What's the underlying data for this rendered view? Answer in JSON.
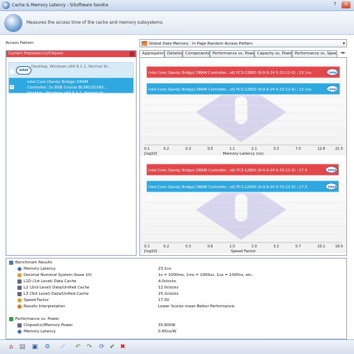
{
  "window": {
    "title": "Cache & Memory Latency - SiSoftware Sandra"
  },
  "banner": {
    "message": "Measures the access time of the cache and memory subsystems."
  },
  "access_pattern": {
    "label": "Access Pattern",
    "selected": "Global Data Memory : In Page Random Access Pattern"
  },
  "devices": {
    "header": "Current Processor(s)/Chipset",
    "items": [
      {
        "icon_text": "intel",
        "line1": "",
        "line2": "",
        "line3": "Desktop, Windows x64 6.1.1, Normal St...",
        "checked": false
      },
      {
        "icon_text": "intel",
        "line1": "Intel Core (Sandy Bridge) DRAM",
        "line2": "Controller; 2x 8GB Crucial BLS8G3D169...",
        "line3": "Desktop, Windows x64 6.1.1, Normal St...",
        "checked": true
      }
    ]
  },
  "tabs": [
    "Aggregated",
    "Detailed",
    "Components",
    "Performance vs. Power",
    "Capacity vs. Power",
    "Performance vs. Speed"
  ],
  "tab_scroll": "◄►",
  "colors": {
    "red": "#e2474b",
    "blue": "#2fa8e0",
    "selected": "#2fa8e0"
  },
  "chart_data": [
    {
      "type": "bar",
      "orientation": "horizontal",
      "xlabel": "Memory Latency (ns)",
      "scale_label": "[log10]",
      "scale": "log",
      "ticks": [
        "0.1",
        "0.2",
        "0.3",
        "0.5",
        "1.1",
        "2.1",
        "3.3",
        "7.0",
        "12.8",
        "21.5"
      ],
      "bars": [
        {
          "label": "Intel Core (Sandy Bridge) DRAM Controller...rd) PC3-12800 (9-9-9-24 5-33-12-6) : 23.1ns",
          "color": "#e2474b",
          "value": 23.1
        },
        {
          "label": "Intel Core (Sandy Bridge) DRAM Controller...rd) PC3-12800 (9-9-9-24 5-33-12-6) : 23.1ns",
          "color": "#2fa8e0",
          "value": 23.1
        }
      ]
    },
    {
      "type": "bar",
      "orientation": "horizontal",
      "xlabel": "Speed Factor",
      "scale_label": "[log10]",
      "scale": "log",
      "ticks": [
        "0.1",
        "0.2",
        "0.3",
        "0.6",
        "1.0",
        "2.0",
        "3.2",
        "5.7",
        "10.1",
        "18.0"
      ],
      "bars": [
        {
          "label": "Intel Core (Sandy Bridge) DRAM Controller...rd) PC3-12800 (9-9-9-24 5-33-12-6) : 17.5",
          "color": "#e2474b",
          "value": 17.5
        },
        {
          "label": "Intel Core (Sandy Bridge) DRAM Controller...rd) PC3-12800 (9-9-9-24 5-33-12-6) : 17.5",
          "color": "#2fa8e0",
          "value": 17.5
        }
      ]
    }
  ],
  "results": [
    {
      "indent": 0,
      "name": "Benchmark Results",
      "value": "",
      "icon": "result-icon",
      "color": "#4a7ab8"
    },
    {
      "indent": 1,
      "name": "Memory Latency",
      "value": "23.1ns",
      "icon": "diamond-icon",
      "color": "#3a6ad0"
    },
    {
      "indent": 1,
      "name": "Decimal Numeral System (base 10)",
      "value": "1s = 1000ms, 1ms = 1000us, 1us = 1000ns, etc.",
      "icon": "star-icon",
      "color": "#e0a020"
    },
    {
      "indent": 1,
      "name": "L1D (1st Level) Data Cache",
      "value": "4.0clocks",
      "icon": "cache-icon",
      "color": "#5a6a80"
    },
    {
      "indent": 1,
      "name": "L2 (2nd Level) Data/Unified Cache",
      "value": "12.0clocks",
      "icon": "cache-icon",
      "color": "#5a6a80"
    },
    {
      "indent": 1,
      "name": "L3 (3rd Level) Data/Unified Cache",
      "value": "25.2clocks",
      "icon": "cache-icon",
      "color": "#5a6a80"
    },
    {
      "indent": 1,
      "name": "Speed Factor",
      "value": "17.50",
      "icon": "star-icon",
      "color": "#e0a020"
    },
    {
      "indent": 1,
      "name": "Results Interpretation",
      "value": "Lower Scores mean Better Performance.",
      "icon": "info-icon",
      "color": "#d08020"
    },
    {
      "indent": 0,
      "name": "",
      "value": "",
      "icon": "",
      "color": ""
    },
    {
      "indent": 0,
      "name": "Performance vs. Power",
      "value": "",
      "icon": "power-icon",
      "color": "#3aa040"
    },
    {
      "indent": 1,
      "name": "Chipset(s)/Memory Power",
      "value": "35.800W",
      "icon": "chip-icon",
      "color": "#5a6a80"
    },
    {
      "indent": 1,
      "name": "Memory Latency",
      "value": "0.65ns/W",
      "icon": "diamond-icon",
      "color": "#3a6ad0"
    }
  ],
  "toolbar": [
    {
      "name": "home-button",
      "glyph": "⌂",
      "color": "#a03030"
    },
    {
      "name": "report-button",
      "glyph": "▤",
      "color": "#6a6a6a"
    },
    {
      "name": "save-button",
      "glyph": "▣",
      "color": "#2a5aa0"
    },
    {
      "name": "options-button",
      "glyph": "⚙",
      "color": "#3a7ab8"
    },
    {
      "name": "chart-button",
      "glyph": "⟋",
      "color": "#3a7ab8"
    },
    {
      "name": "back-button",
      "glyph": "↶",
      "color": "#3a9a3a"
    },
    {
      "name": "forward-button",
      "glyph": "↷",
      "color": "#3a9a3a"
    },
    {
      "name": "refresh-button",
      "glyph": "⟳",
      "color": "#3a6ad0"
    },
    {
      "name": "ok-button",
      "glyph": "✔",
      "color": "#2a8a3a"
    },
    {
      "name": "cancel-button",
      "glyph": "✖",
      "color": "#d02020"
    }
  ]
}
